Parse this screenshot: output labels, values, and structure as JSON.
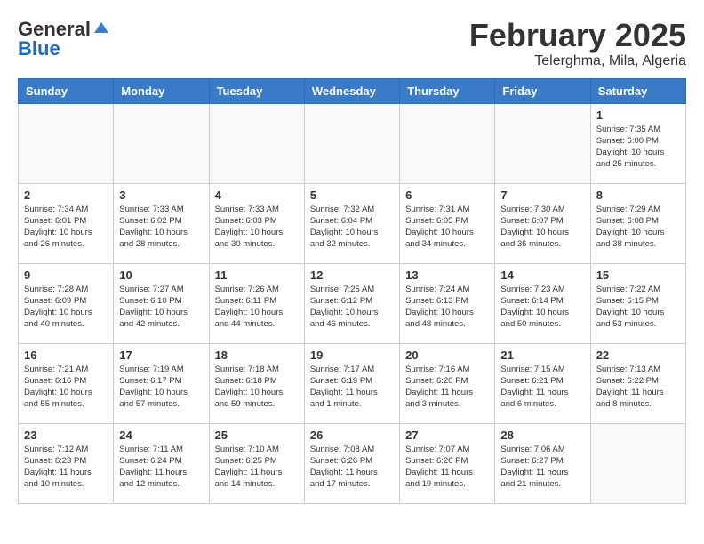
{
  "header": {
    "logo_general": "General",
    "logo_blue": "Blue",
    "month_year": "February 2025",
    "location": "Telerghma, Mila, Algeria"
  },
  "weekdays": [
    "Sunday",
    "Monday",
    "Tuesday",
    "Wednesday",
    "Thursday",
    "Friday",
    "Saturday"
  ],
  "weeks": [
    [
      {
        "day": "",
        "info": ""
      },
      {
        "day": "",
        "info": ""
      },
      {
        "day": "",
        "info": ""
      },
      {
        "day": "",
        "info": ""
      },
      {
        "day": "",
        "info": ""
      },
      {
        "day": "",
        "info": ""
      },
      {
        "day": "1",
        "info": "Sunrise: 7:35 AM\nSunset: 6:00 PM\nDaylight: 10 hours and 25 minutes."
      }
    ],
    [
      {
        "day": "2",
        "info": "Sunrise: 7:34 AM\nSunset: 6:01 PM\nDaylight: 10 hours and 26 minutes."
      },
      {
        "day": "3",
        "info": "Sunrise: 7:33 AM\nSunset: 6:02 PM\nDaylight: 10 hours and 28 minutes."
      },
      {
        "day": "4",
        "info": "Sunrise: 7:33 AM\nSunset: 6:03 PM\nDaylight: 10 hours and 30 minutes."
      },
      {
        "day": "5",
        "info": "Sunrise: 7:32 AM\nSunset: 6:04 PM\nDaylight: 10 hours and 32 minutes."
      },
      {
        "day": "6",
        "info": "Sunrise: 7:31 AM\nSunset: 6:05 PM\nDaylight: 10 hours and 34 minutes."
      },
      {
        "day": "7",
        "info": "Sunrise: 7:30 AM\nSunset: 6:07 PM\nDaylight: 10 hours and 36 minutes."
      },
      {
        "day": "8",
        "info": "Sunrise: 7:29 AM\nSunset: 6:08 PM\nDaylight: 10 hours and 38 minutes."
      }
    ],
    [
      {
        "day": "9",
        "info": "Sunrise: 7:28 AM\nSunset: 6:09 PM\nDaylight: 10 hours and 40 minutes."
      },
      {
        "day": "10",
        "info": "Sunrise: 7:27 AM\nSunset: 6:10 PM\nDaylight: 10 hours and 42 minutes."
      },
      {
        "day": "11",
        "info": "Sunrise: 7:26 AM\nSunset: 6:11 PM\nDaylight: 10 hours and 44 minutes."
      },
      {
        "day": "12",
        "info": "Sunrise: 7:25 AM\nSunset: 6:12 PM\nDaylight: 10 hours and 46 minutes."
      },
      {
        "day": "13",
        "info": "Sunrise: 7:24 AM\nSunset: 6:13 PM\nDaylight: 10 hours and 48 minutes."
      },
      {
        "day": "14",
        "info": "Sunrise: 7:23 AM\nSunset: 6:14 PM\nDaylight: 10 hours and 50 minutes."
      },
      {
        "day": "15",
        "info": "Sunrise: 7:22 AM\nSunset: 6:15 PM\nDaylight: 10 hours and 53 minutes."
      }
    ],
    [
      {
        "day": "16",
        "info": "Sunrise: 7:21 AM\nSunset: 6:16 PM\nDaylight: 10 hours and 55 minutes."
      },
      {
        "day": "17",
        "info": "Sunrise: 7:19 AM\nSunset: 6:17 PM\nDaylight: 10 hours and 57 minutes."
      },
      {
        "day": "18",
        "info": "Sunrise: 7:18 AM\nSunset: 6:18 PM\nDaylight: 10 hours and 59 minutes."
      },
      {
        "day": "19",
        "info": "Sunrise: 7:17 AM\nSunset: 6:19 PM\nDaylight: 11 hours and 1 minute."
      },
      {
        "day": "20",
        "info": "Sunrise: 7:16 AM\nSunset: 6:20 PM\nDaylight: 11 hours and 3 minutes."
      },
      {
        "day": "21",
        "info": "Sunrise: 7:15 AM\nSunset: 6:21 PM\nDaylight: 11 hours and 6 minutes."
      },
      {
        "day": "22",
        "info": "Sunrise: 7:13 AM\nSunset: 6:22 PM\nDaylight: 11 hours and 8 minutes."
      }
    ],
    [
      {
        "day": "23",
        "info": "Sunrise: 7:12 AM\nSunset: 6:23 PM\nDaylight: 11 hours and 10 minutes."
      },
      {
        "day": "24",
        "info": "Sunrise: 7:11 AM\nSunset: 6:24 PM\nDaylight: 11 hours and 12 minutes."
      },
      {
        "day": "25",
        "info": "Sunrise: 7:10 AM\nSunset: 6:25 PM\nDaylight: 11 hours and 14 minutes."
      },
      {
        "day": "26",
        "info": "Sunrise: 7:08 AM\nSunset: 6:26 PM\nDaylight: 11 hours and 17 minutes."
      },
      {
        "day": "27",
        "info": "Sunrise: 7:07 AM\nSunset: 6:26 PM\nDaylight: 11 hours and 19 minutes."
      },
      {
        "day": "28",
        "info": "Sunrise: 7:06 AM\nSunset: 6:27 PM\nDaylight: 11 hours and 21 minutes."
      },
      {
        "day": "",
        "info": ""
      }
    ]
  ]
}
